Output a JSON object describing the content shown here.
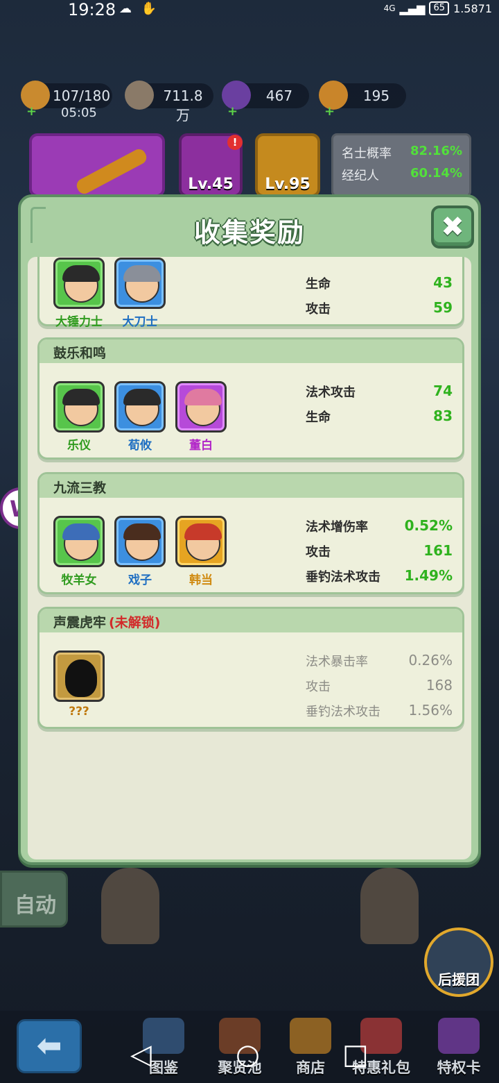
{
  "status_bar": {
    "time": "19:28",
    "network": "4G",
    "battery": "65",
    "extra": "1.5871"
  },
  "resources": {
    "stamina": {
      "value": "107/180",
      "timer": "05:05"
    },
    "coins": {
      "value": "711.8万"
    },
    "gems": {
      "value": "467"
    },
    "tokens": {
      "value": "195"
    }
  },
  "background_cards": {
    "card2_level": "Lv.45",
    "card3_level": "Lv.95",
    "info": [
      {
        "label": "名士概率",
        "value": "82.16%"
      },
      {
        "label": "经纪人",
        "value": "60.14%"
      }
    ]
  },
  "modal": {
    "title": "收集奖励",
    "close_label": "✖"
  },
  "groups": [
    {
      "name": "",
      "heroes": [
        {
          "name": "大锤力士",
          "rarity": "green"
        },
        {
          "name": "大刀士",
          "rarity": "blue"
        }
      ],
      "stats": [
        {
          "label": "生命",
          "value": "43"
        },
        {
          "label": "攻击",
          "value": "59"
        }
      ]
    },
    {
      "name": "鼓乐和鸣",
      "heroes": [
        {
          "name": "乐仪",
          "rarity": "green"
        },
        {
          "name": "荀攸",
          "rarity": "blue"
        },
        {
          "name": "董白",
          "rarity": "purple"
        }
      ],
      "stats": [
        {
          "label": "法术攻击",
          "value": "74"
        },
        {
          "label": "生命",
          "value": "83"
        }
      ]
    },
    {
      "name": "九流三教",
      "heroes": [
        {
          "name": "牧羊女",
          "rarity": "green"
        },
        {
          "name": "戏子",
          "rarity": "blue"
        },
        {
          "name": "韩当",
          "rarity": "gold"
        }
      ],
      "stats": [
        {
          "label": "法术增伤率",
          "value": "0.52%"
        },
        {
          "label": "攻击",
          "value": "161"
        },
        {
          "label": "垂钓法术攻击",
          "value": "1.49%"
        }
      ]
    },
    {
      "name": "声震虎牢",
      "locked_label": "(未解锁)",
      "heroes": [
        {
          "name": "???",
          "rarity": "unknown"
        }
      ],
      "stats": [
        {
          "label": "法术暴击率",
          "value": "0.26%"
        },
        {
          "label": "攻击",
          "value": "168"
        },
        {
          "label": "垂钓法术攻击",
          "value": "1.56%"
        }
      ]
    }
  ],
  "bottom": {
    "auto_label": "自动",
    "support_label": "后援团",
    "back_label": "⬅",
    "nav": [
      "图鉴",
      "聚贤池",
      "商店",
      "特惠礼包",
      "特权卡"
    ]
  },
  "system_nav": {
    "back": "◁",
    "home": "○",
    "recent": "□"
  }
}
